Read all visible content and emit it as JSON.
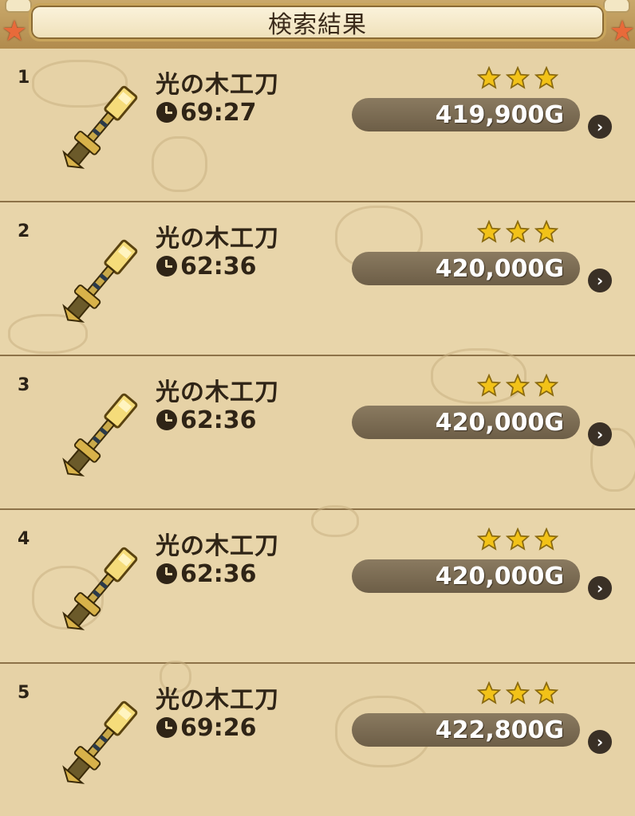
{
  "header": {
    "title": "検索結果"
  },
  "icons": {
    "corner_left": "starfish-icon",
    "corner_right": "starfish-icon",
    "weapon": "wooden-sword-icon",
    "timer": "clock-icon",
    "rating": "star-icon",
    "detail": "chevron-right-icon"
  },
  "colors": {
    "star": "#f2c218",
    "price_pill": "#7b6b52",
    "background": "#e6d3a8"
  },
  "results": [
    {
      "index": "1",
      "name": "光の木工刀",
      "time": "69:27",
      "stars": 3,
      "price": "419,900G"
    },
    {
      "index": "2",
      "name": "光の木工刀",
      "time": "62:36",
      "stars": 3,
      "price": "420,000G"
    },
    {
      "index": "3",
      "name": "光の木工刀",
      "time": "62:36",
      "stars": 3,
      "price": "420,000G"
    },
    {
      "index": "4",
      "name": "光の木工刀",
      "time": "62:36",
      "stars": 3,
      "price": "420,000G"
    },
    {
      "index": "5",
      "name": "光の木工刀",
      "time": "69:26",
      "stars": 3,
      "price": "422,800G"
    }
  ]
}
